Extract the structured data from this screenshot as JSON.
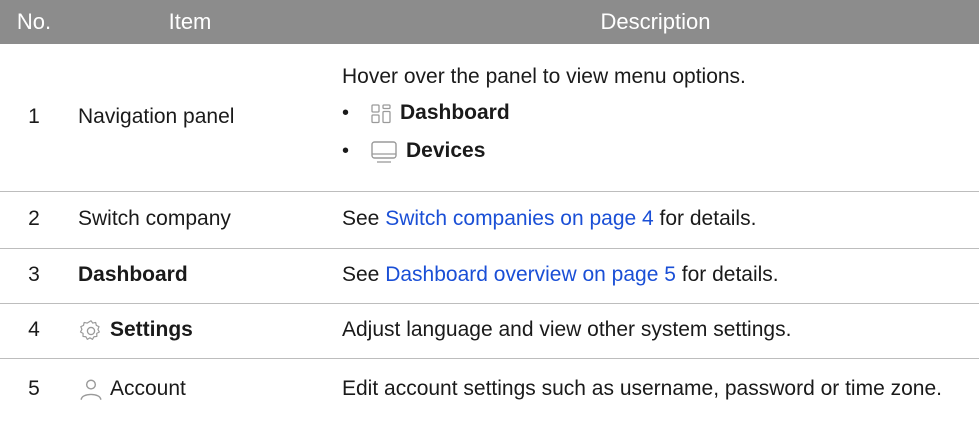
{
  "headers": {
    "no": "No.",
    "item": "Item",
    "description": "Description"
  },
  "rows": [
    {
      "no": "1",
      "item": "Navigation panel",
      "intro": "Hover over the panel to view menu options.",
      "bullets": [
        {
          "icon": "dashboard-grid-icon",
          "label": "Dashboard"
        },
        {
          "icon": "device-monitor-icon",
          "label": "Devices"
        }
      ]
    },
    {
      "no": "2",
      "item": "Switch company",
      "pre": "See ",
      "link": "Switch companies on page 4",
      "post": " for details."
    },
    {
      "no": "3",
      "item": "Dashboard",
      "pre": "See ",
      "link": "Dashboard overview on page 5",
      "post": " for details."
    },
    {
      "no": "4",
      "icon": "settings-gear-icon",
      "item": "Settings",
      "description": "Adjust language and view other system settings."
    },
    {
      "no": "5",
      "icon": "account-person-icon",
      "item": "Account",
      "description": "Edit account settings such as username, password or time zone."
    }
  ],
  "colors": {
    "header_bg": "#8c8c8c",
    "link": "#1a4fd6",
    "divider": "#bdbdbd"
  }
}
